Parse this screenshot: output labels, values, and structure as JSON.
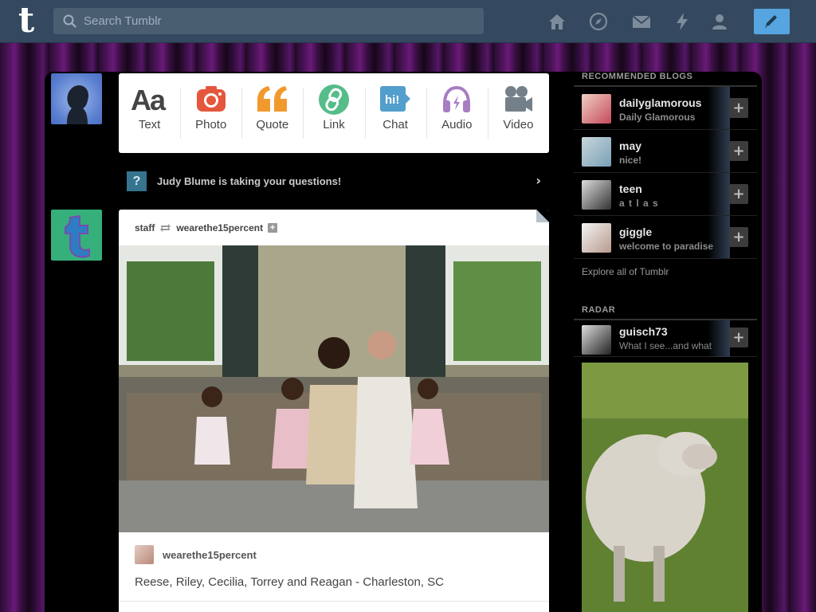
{
  "topbar": {
    "logo": "t",
    "search_placeholder": "Search Tumblr",
    "nav_icons": [
      "home-icon",
      "explore-icon",
      "inbox-icon",
      "activity-icon",
      "account-icon"
    ],
    "compose_icon": "pencil-icon",
    "accent": "#56a5e0"
  },
  "post_types": [
    {
      "label": "Text",
      "icon": "text-icon",
      "color": "#444444"
    },
    {
      "label": "Photo",
      "icon": "camera-icon",
      "color": "#e4573d"
    },
    {
      "label": "Quote",
      "icon": "quote-icon",
      "color": "#f2992e"
    },
    {
      "label": "Link",
      "icon": "link-icon",
      "color": "#56bc8a"
    },
    {
      "label": "Chat",
      "icon": "chat-icon",
      "color": "#529ecc"
    },
    {
      "label": "Audio",
      "icon": "headphones-icon",
      "color": "#a77dc2"
    },
    {
      "label": "Video",
      "icon": "video-camera-icon",
      "color": "#748089"
    }
  ],
  "question_bar": {
    "icon": "?",
    "text": "Judy Blume is taking your questions!"
  },
  "post": {
    "author": "staff",
    "reblogged_from": "wearethe15percent",
    "source_name": "wearethe15percent",
    "caption": "Reese, Riley, Cecilia, Torrey and Reagan - Charleston, SC"
  },
  "sidebar": {
    "recommended_title": "RECOMMENDED BLOGS",
    "blogs": [
      {
        "name": "dailyglamorous",
        "subtitle": "Daily Glamorous",
        "avatar_color": "#c44a5a"
      },
      {
        "name": "may",
        "subtitle": "nice!",
        "avatar_color": "#7aa0b6"
      },
      {
        "name": "teen",
        "subtitle": "a t l a s",
        "avatar_color": "#6a6a6a"
      },
      {
        "name": "giggle",
        "subtitle": "welcome to paradise",
        "avatar_color": "#d8d8d8"
      }
    ],
    "explore_link": "Explore all of Tumblr",
    "radar_title": "RADAR",
    "radar": {
      "name": "guisch73",
      "subtitle": "What I see...and what"
    },
    "follow_glyph": "+"
  }
}
